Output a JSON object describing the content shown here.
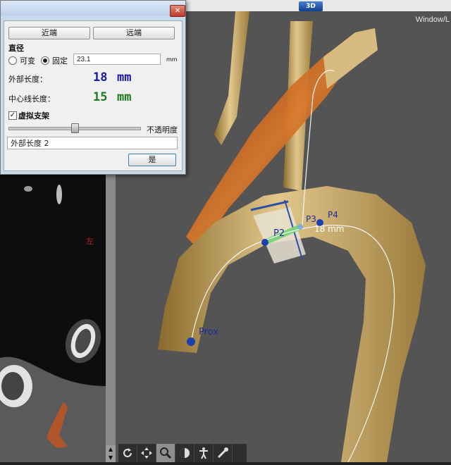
{
  "topbar": {
    "tab_3d": "3D"
  },
  "view3d": {
    "window_label": "Window/L",
    "markers": {
      "p2": "P2",
      "p3": "P3",
      "p4": "P4",
      "prox": "Prox"
    },
    "measurement": "18 mm"
  },
  "ct_view": {
    "side_label": "左"
  },
  "dialog": {
    "close_label": "✕",
    "near_button": "近端",
    "far_button": "远端",
    "diameter_heading": "直径",
    "variable_label": "可变",
    "fixed_label": "固定",
    "fixed_selected": true,
    "diameter_value": "23.1",
    "unit": "mm",
    "outer_length_label": "外部长度：",
    "outer_length_value": "18",
    "centerline_label": "中心线长度：",
    "centerline_value": "15",
    "length_unit": "mm",
    "virtual_stent_label": "虚拟支架",
    "virtual_stent_checked": "✓",
    "opacity_label": "不透明度",
    "opacity_level": 0.5,
    "name_value": "外部长度 2",
    "ok_button": "是",
    "colors": {
      "outer": "#1a1aa8",
      "centerline": "#1f7a1f"
    }
  },
  "toolbar": {
    "icons": [
      "rotate-icon",
      "pan-icon",
      "zoom-icon",
      "contrast-icon",
      "body-icon",
      "tools-icon"
    ],
    "active": "zoom-icon"
  }
}
